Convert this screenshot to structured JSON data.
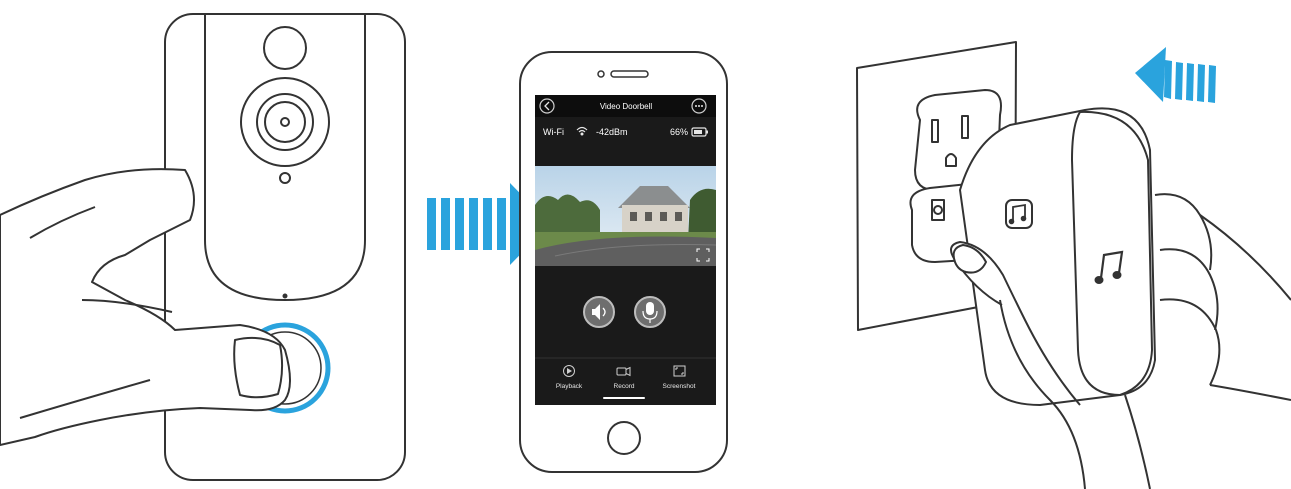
{
  "app": {
    "title": "Video Doorbell",
    "status": {
      "wifi_label": "Wi-Fi",
      "signal": "-42dBm",
      "battery": "66%"
    },
    "toolbar": {
      "playback_label": "Playback",
      "record_label": "Record",
      "screenshot_label": "Screenshot"
    }
  },
  "colors": {
    "accent_blue": "#2aa3dd",
    "phone_screen_bg": "#1a1a1a",
    "line_art": "#333333"
  },
  "icons": {
    "back": "chevron-left-icon",
    "more": "more-icon",
    "wifi": "wifi-icon",
    "battery": "battery-icon",
    "speaker": "speaker-icon",
    "microphone": "microphone-icon",
    "playback": "playback-icon",
    "record": "record-icon",
    "screenshot": "screenshot-icon",
    "fullscreen": "fullscreen-icon",
    "music_note": "music-note-icon"
  }
}
